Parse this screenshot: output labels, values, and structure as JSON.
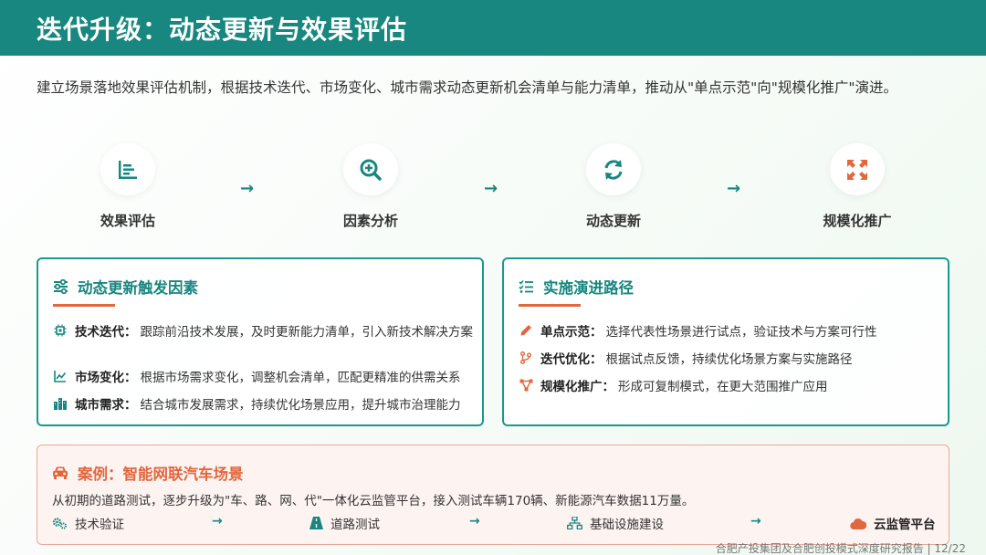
{
  "header": {
    "title": "迭代升级：动态更新与效果评估"
  },
  "intro": "建立场景落地效果评估机制，根据技术迭代、市场变化、城市需求动态更新机会清单与能力清单，推动从\"单点示范\"向\"规模化推广\"演进。",
  "steps": [
    {
      "label": "效果评估",
      "icon": "bar-chart-icon"
    },
    {
      "label": "因素分析",
      "icon": "search-plus-icon"
    },
    {
      "label": "动态更新",
      "icon": "refresh-icon"
    },
    {
      "label": "规模化推广",
      "icon": "expand-icon"
    }
  ],
  "triggers": {
    "title": "动态更新触发因素",
    "items": [
      {
        "key": "技术迭代：",
        "text": "跟踪前沿技术发展，及时更新能力清单，引入新技术解决方案",
        "icon": "chip-icon"
      },
      {
        "key": "市场变化：",
        "text": "根据市场需求变化，调整机会清单，匹配更精准的供需关系",
        "icon": "line-chart-icon"
      },
      {
        "key": "城市需求：",
        "text": "结合城市发展需求，持续优化场景应用，提升城市治理能力",
        "icon": "city-icon"
      }
    ]
  },
  "path": {
    "title": "实施演进路径",
    "items": [
      {
        "key": "单点示范：",
        "text": "选择代表性场景进行试点，验证技术与方案可行性",
        "icon": "pen-icon"
      },
      {
        "key": "迭代优化：",
        "text": "根据试点反馈，持续优化场景方案与实施路径",
        "icon": "branch-icon"
      },
      {
        "key": "规模化推广：",
        "text": "形成可复制模式，在更大范围推广应用",
        "icon": "network-icon"
      }
    ]
  },
  "case": {
    "title": "案例：智能网联汽车场景",
    "desc": "从初期的道路测试，逐步升级为\"车、路、网、代\"一体化云监管平台，接入测试车辆170辆、新能源汽车数据11万量。",
    "flow": [
      {
        "label": "技术验证",
        "icon": "gears-icon"
      },
      {
        "label": "道路测试",
        "icon": "road-icon"
      },
      {
        "label": "基础设施建设",
        "icon": "sitemap-icon"
      },
      {
        "label": "云监管平台",
        "icon": "cloud-icon"
      }
    ],
    "arrow": "→"
  },
  "footer": "合肥产投集团及合肥创投模式深度研究报告 | 12/22",
  "colors": {
    "teal": "#17877f",
    "orange": "#e2673e",
    "border": "#1a9a8c"
  }
}
